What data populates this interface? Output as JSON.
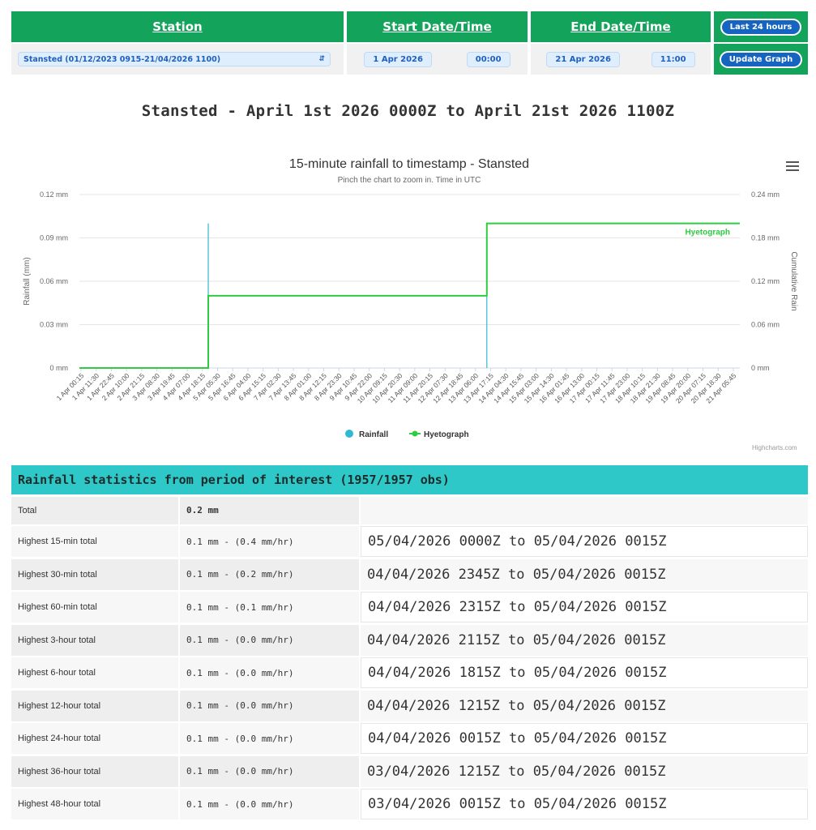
{
  "controls": {
    "station_header": "Station",
    "start_header": "Start Date/Time",
    "end_header": "End Date/Time",
    "last24_label": "Last 24 hours",
    "station_value": "Stansted (01/12/2023 0915-21/04/2026 1100)",
    "start_date": "1 Apr 2026",
    "start_time": "00:00",
    "end_date": "21 Apr 2026",
    "end_time": "11:00",
    "update_label": "Update Graph"
  },
  "page_title": "Stansted - April 1st 2026 0000Z to April 21st 2026 1100Z",
  "credits": "Highcharts.com",
  "colors": {
    "header_green": "#14a35a",
    "teal": "#2ec8c8",
    "rainfall": "#31b9d4",
    "hyetograph": "#2ecc40"
  },
  "icons": {
    "menu": "hamburger-menu-icon",
    "select": "select-arrows-icon"
  },
  "chart_data": {
    "type": "line",
    "title": "15-minute rainfall to timestamp - Stansted",
    "subtitle": "Pinch the chart to zoom in. Time in UTC",
    "ylabel_left": "Rainfall (mm)",
    "ylabel_right": "Cumulative Rain",
    "yticks_left": [
      "0.12 mm",
      "0.09 mm",
      "0.06 mm",
      "0.03 mm",
      "0 mm"
    ],
    "yticks_right": [
      "0.24 mm",
      "0.18 mm",
      "0.12 mm",
      "0.06 mm",
      "0 mm"
    ],
    "ylim_left": [
      0,
      0.12
    ],
    "ylim_right": [
      0,
      0.24
    ],
    "grid": true,
    "legend_position": "bottom-center",
    "xticks": [
      "1 Apr 00:15",
      "1 Apr 11:30",
      "1 Apr 22:45",
      "2 Apr 10:00",
      "2 Apr 21:15",
      "3 Apr 08:30",
      "3 Apr 19:45",
      "4 Apr 07:00",
      "4 Apr 18:15",
      "5 Apr 05:30",
      "5 Apr 16:45",
      "6 Apr 04:00",
      "6 Apr 15:15",
      "7 Apr 02:30",
      "7 Apr 13:45",
      "8 Apr 01:00",
      "8 Apr 12:15",
      "8 Apr 23:30",
      "9 Apr 10:45",
      "9 Apr 22:00",
      "10 Apr 09:15",
      "10 Apr 20:30",
      "11 Apr 09:00",
      "11 Apr 20:15",
      "12 Apr 07:30",
      "12 Apr 18:45",
      "13 Apr 06:00",
      "13 Apr 17:15",
      "14 Apr 04:30",
      "14 Apr 15:45",
      "15 Apr 03:00",
      "15 Apr 14:30",
      "16 Apr 01:45",
      "16 Apr 13:00",
      "17 Apr 00:15",
      "17 Apr 11:45",
      "17 Apr 23:00",
      "18 Apr 10:15",
      "18 Apr 21:30",
      "19 Apr 08:45",
      "19 Apr 20:00",
      "20 Apr 07:15",
      "20 Apr 18:30",
      "21 Apr 05:45"
    ],
    "x_range": [
      "1 Apr 00:15",
      "21 Apr 11:00"
    ],
    "series": [
      {
        "name": "Rainfall",
        "type": "column",
        "axis": "left",
        "points": [
          {
            "x": "5 Apr 00:00",
            "y": 0.1
          },
          {
            "x": "13 Apr 15:00",
            "y": 0.1
          }
        ]
      },
      {
        "name": "Hyetograph",
        "type": "step-line",
        "axis": "right",
        "points": [
          {
            "x": "1 Apr 00:15",
            "y": 0
          },
          {
            "x": "5 Apr 00:00",
            "y": 0.1
          },
          {
            "x": "13 Apr 15:00",
            "y": 0.2
          },
          {
            "x": "21 Apr 11:00",
            "y": 0.2
          }
        ]
      }
    ],
    "annotations": [
      "Hyetograph"
    ]
  },
  "stats": {
    "title": "Rainfall statistics from period of interest (1957/1957 obs)",
    "rows": [
      {
        "label": "Total",
        "value": "0.2 mm",
        "period": ""
      },
      {
        "label": "Highest 15-min total",
        "value": "0.1 mm - (0.4 mm/hr)",
        "period": "05/04/2026 0000Z to 05/04/2026 0015Z"
      },
      {
        "label": "Highest 30-min total",
        "value": "0.1 mm - (0.2 mm/hr)",
        "period": "04/04/2026 2345Z to 05/04/2026 0015Z"
      },
      {
        "label": "Highest 60-min total",
        "value": "0.1 mm - (0.1 mm/hr)",
        "period": "04/04/2026 2315Z to 05/04/2026 0015Z"
      },
      {
        "label": "Highest 3-hour total",
        "value": "0.1 mm - (0.0 mm/hr)",
        "period": "04/04/2026 2115Z to 05/04/2026 0015Z"
      },
      {
        "label": "Highest 6-hour total",
        "value": "0.1 mm - (0.0 mm/hr)",
        "period": "04/04/2026 1815Z to 05/04/2026 0015Z"
      },
      {
        "label": "Highest 12-hour total",
        "value": "0.1 mm - (0.0 mm/hr)",
        "period": "04/04/2026 1215Z to 05/04/2026 0015Z"
      },
      {
        "label": "Highest 24-hour total",
        "value": "0.1 mm - (0.0 mm/hr)",
        "period": "04/04/2026 0015Z to 05/04/2026 0015Z"
      },
      {
        "label": "Highest 36-hour total",
        "value": "0.1 mm - (0.0 mm/hr)",
        "period": "03/04/2026 1215Z to 05/04/2026 0015Z"
      },
      {
        "label": "Highest 48-hour total",
        "value": "0.1 mm - (0.0 mm/hr)",
        "period": "03/04/2026 0015Z to 05/04/2026 0015Z"
      }
    ]
  }
}
